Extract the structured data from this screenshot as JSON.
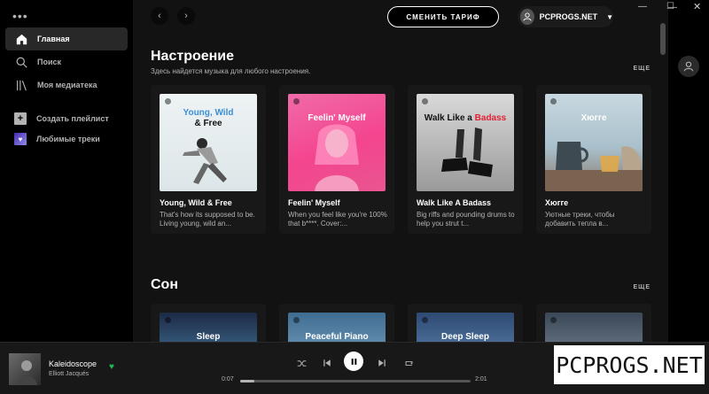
{
  "sidebar": {
    "items": [
      {
        "label": "Главная",
        "icon": "home-icon",
        "active": true
      },
      {
        "label": "Поиск",
        "icon": "search-icon"
      },
      {
        "label": "Моя медиатека",
        "icon": "library-icon"
      }
    ],
    "create_playlist": "Создать плейлист",
    "liked_songs": "Любимые треки"
  },
  "header": {
    "upgrade_label": "СМЕНИТЬ ТАРИФ",
    "user_name": "PCPROGS.NET"
  },
  "sections": [
    {
      "title": "Настроение",
      "subtitle": "Здесь найдется музыка для любого настроения.",
      "see_all": "ЕЩЕ",
      "cards": [
        {
          "cover_text_1": "Young, Wild",
          "cover_text_2": "& Free",
          "title": "Young, Wild & Free",
          "desc": "That's how its supposed to be. Living young, wild an..."
        },
        {
          "cover_text_1": "Feelin' Myself",
          "title": "Feelin' Myself",
          "desc": "When you feel like you're 100% that b****. Cover:..."
        },
        {
          "cover_text_1": "Walk Like a",
          "cover_text_2": "Badass",
          "title": "Walk Like A Badass",
          "desc": "Big riffs and pounding drums to help you strut t..."
        },
        {
          "cover_text_1": "Хюгге",
          "title": "Хюгге",
          "desc": "Уютные треки, чтобы добавить тепла в..."
        }
      ]
    },
    {
      "title": "Сон",
      "see_all": "ЕЩЕ",
      "cards": [
        {
          "cover_text_1": "Sleep"
        },
        {
          "cover_text_1": "Peaceful Piano"
        },
        {
          "cover_text_1": "Deep Sleep"
        },
        {
          "cover_text_1": ""
        }
      ]
    }
  ],
  "player": {
    "track": "Kaleidoscope",
    "artist": "Elliott Jacqués",
    "elapsed": "0:07",
    "duration": "2:01",
    "progress": 0.06
  },
  "watermark": "PCPROGS.NET",
  "colors": {
    "accent": "#1db954",
    "badass_red": "#e22134"
  }
}
